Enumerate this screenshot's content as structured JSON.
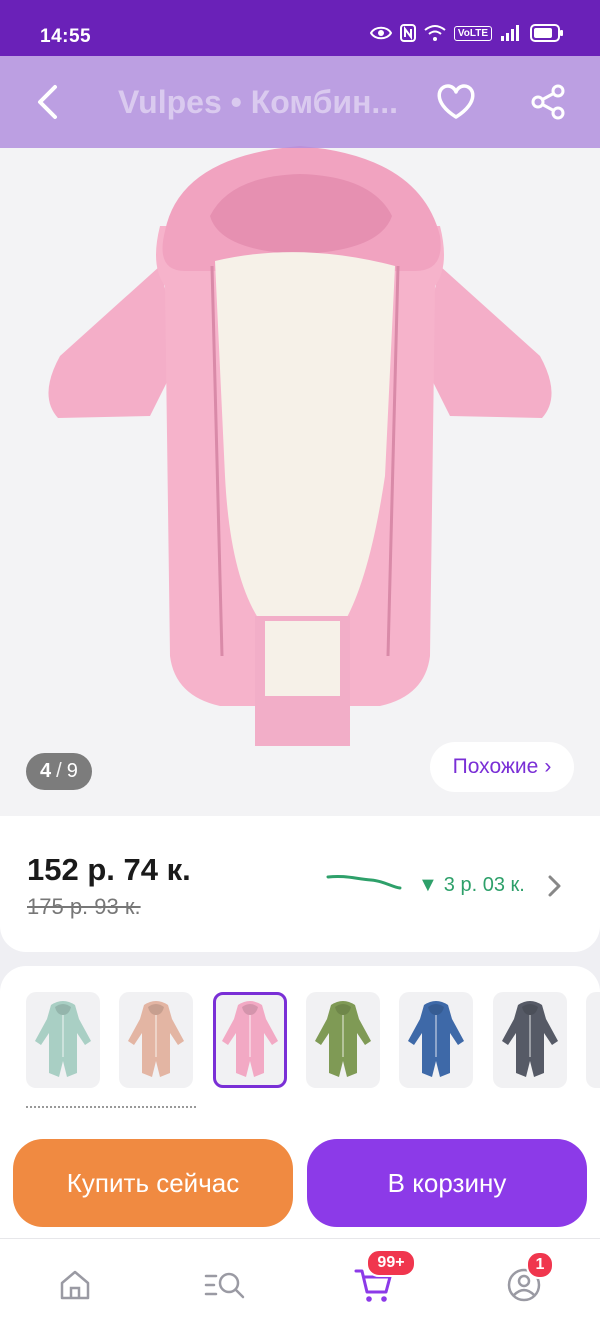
{
  "status_bar": {
    "time": "14:55",
    "network_label": "VoLTE"
  },
  "header": {
    "title": "Vulpes • Комбин...",
    "back_icon": "chevron-left-icon",
    "favorite_icon": "heart-icon",
    "share_icon": "share-icon"
  },
  "gallery": {
    "current_index": "4",
    "separator": "/",
    "total": "9",
    "similar_label": "Похожие",
    "similar_chevron": "›"
  },
  "price": {
    "current": "152 р. 74 к.",
    "old": "175 р. 93 к.",
    "drop_label": "3 р. 03 к.",
    "drop_arrow": "▼",
    "trend_color": "#2ea06a"
  },
  "variants": {
    "items": [
      {
        "color_name": "mint",
        "color": "#a9cfc4"
      },
      {
        "color_name": "beige",
        "color": "#e3b5a3"
      },
      {
        "color_name": "pink",
        "color": "#f2a9c4",
        "selected": true
      },
      {
        "color_name": "olive",
        "color": "#7f9a55"
      },
      {
        "color_name": "blue",
        "color": "#3e69a8"
      },
      {
        "color_name": "graphite",
        "color": "#565a66"
      }
    ]
  },
  "actions": {
    "buy_now_label": "Купить сейчас",
    "add_to_cart_label": "В корзину",
    "buy_color": "#f08a41",
    "cart_color": "#8c3ae8"
  },
  "bottom_nav": {
    "items": [
      {
        "name": "home-icon"
      },
      {
        "name": "catalog-search-icon"
      },
      {
        "name": "cart-icon",
        "badge": "99+"
      },
      {
        "name": "profile-icon",
        "badge": "1"
      }
    ]
  },
  "colors": {
    "brand": "#6a21b8",
    "accent": "#7a2fd6"
  }
}
